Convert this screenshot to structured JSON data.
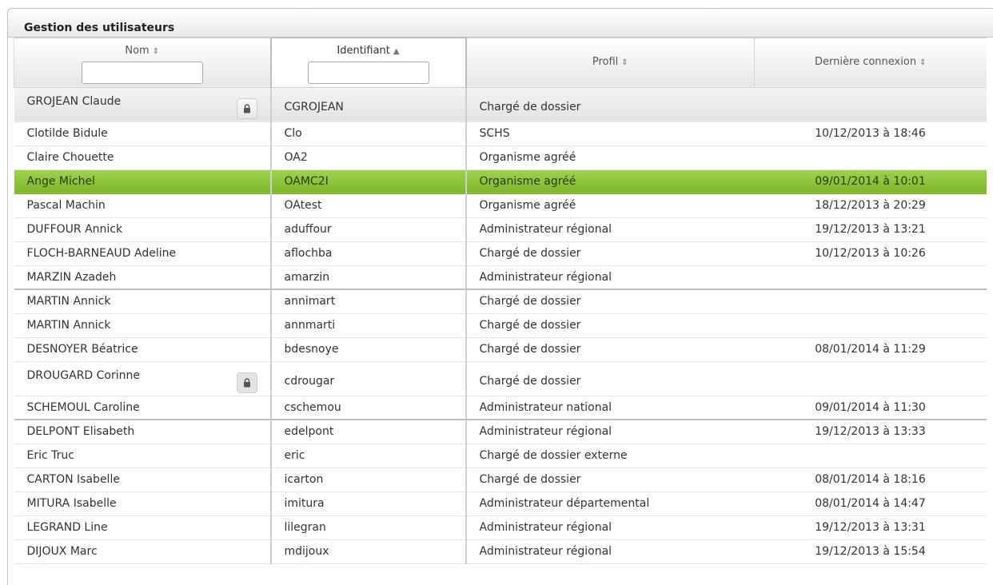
{
  "panel": {
    "title": "Gestion des utilisateurs"
  },
  "columns": [
    {
      "label": "Nom",
      "sort_icon": "sort-both-icon",
      "sort_glyph": "⇕",
      "has_filter": true
    },
    {
      "label": "Identifiant",
      "sort_icon": "sort-asc-icon",
      "sort_glyph": "▲",
      "has_filter": true
    },
    {
      "label": "Profil",
      "sort_icon": "sort-both-icon",
      "sort_glyph": "⇕",
      "has_filter": false
    },
    {
      "label": "Dernière connexion",
      "sort_icon": "sort-both-icon",
      "sort_glyph": "⇕",
      "has_filter": false
    }
  ],
  "filters": {
    "nom_value": "",
    "identifiant_value": ""
  },
  "rows": [
    {
      "nom": "GROJEAN Claude",
      "identifiant": "CGROJEAN",
      "profil": "Chargé de dossier",
      "connexion": "",
      "lock": true,
      "style": "grey"
    },
    {
      "nom": "Clotilde Bidule",
      "identifiant": "Clo",
      "profil": "SCHS",
      "connexion": "10/12/2013 à 18:46"
    },
    {
      "nom": "Claire Chouette",
      "identifiant": "OA2",
      "profil": "Organisme agréé",
      "connexion": ""
    },
    {
      "nom": "Ange Michel",
      "identifiant": "OAMC2I",
      "profil": "Organisme agréé",
      "connexion": "09/01/2014 à 10:01",
      "style": "sel"
    },
    {
      "nom": "Pascal Machin",
      "identifiant": "OAtest",
      "profil": "Organisme agréé",
      "connexion": "18/12/2013 à 20:29"
    },
    {
      "nom": "DUFFOUR Annick",
      "identifiant": "aduffour",
      "profil": "Administrateur régional",
      "connexion": "19/12/2013 à 13:21"
    },
    {
      "nom": "FLOCH-BARNEAUD Adeline",
      "identifiant": "aflochba",
      "profil": "Chargé de dossier",
      "connexion": "10/12/2013 à 10:26"
    },
    {
      "nom": "MARZIN Azadeh",
      "identifiant": "amarzin",
      "profil": "Administrateur régional",
      "connexion": "",
      "style": "sep"
    },
    {
      "nom": "MARTIN Annick",
      "identifiant": "annimart",
      "profil": "Chargé de dossier",
      "connexion": ""
    },
    {
      "nom": "MARTIN Annick",
      "identifiant": "annmarti",
      "profil": "Chargé de dossier",
      "connexion": ""
    },
    {
      "nom": "DESNOYER Béatrice",
      "identifiant": "bdesnoye",
      "profil": "Chargé de dossier",
      "connexion": "08/01/2014 à 11:29"
    },
    {
      "nom": "DROUGARD Corinne",
      "identifiant": "cdrougar",
      "profil": "Chargé de dossier",
      "connexion": "",
      "lock": true,
      "lock_dim": true
    },
    {
      "nom": "SCHEMOUL Caroline",
      "identifiant": "cschemou",
      "profil": "Administrateur national",
      "connexion": "09/01/2014 à 11:30",
      "style": "sep"
    },
    {
      "nom": "DELPONT Elisabeth",
      "identifiant": "edelpont",
      "profil": "Administrateur régional",
      "connexion": "19/12/2013 à 13:33"
    },
    {
      "nom": "Eric Truc",
      "identifiant": "eric",
      "profil": "Chargé de dossier externe",
      "connexion": ""
    },
    {
      "nom": "CARTON Isabelle",
      "identifiant": "icarton",
      "profil": "Chargé de dossier",
      "connexion": "08/01/2014 à 18:16"
    },
    {
      "nom": "MITURA Isabelle",
      "identifiant": "imitura",
      "profil": "Administrateur départemental",
      "connexion": "08/01/2014 à 14:47"
    },
    {
      "nom": "LEGRAND Line",
      "identifiant": "lilegran",
      "profil": "Administrateur régional",
      "connexion": "19/12/2013 à 13:31"
    },
    {
      "nom": "DIJOUX Marc",
      "identifiant": "mdijoux",
      "profil": "Administrateur régional",
      "connexion": "19/12/2013 à 15:54"
    }
  ],
  "colors": {
    "selected_row": "#8dc43a",
    "header_bg": "#e9e9e9",
    "border": "#bfbfbf"
  }
}
